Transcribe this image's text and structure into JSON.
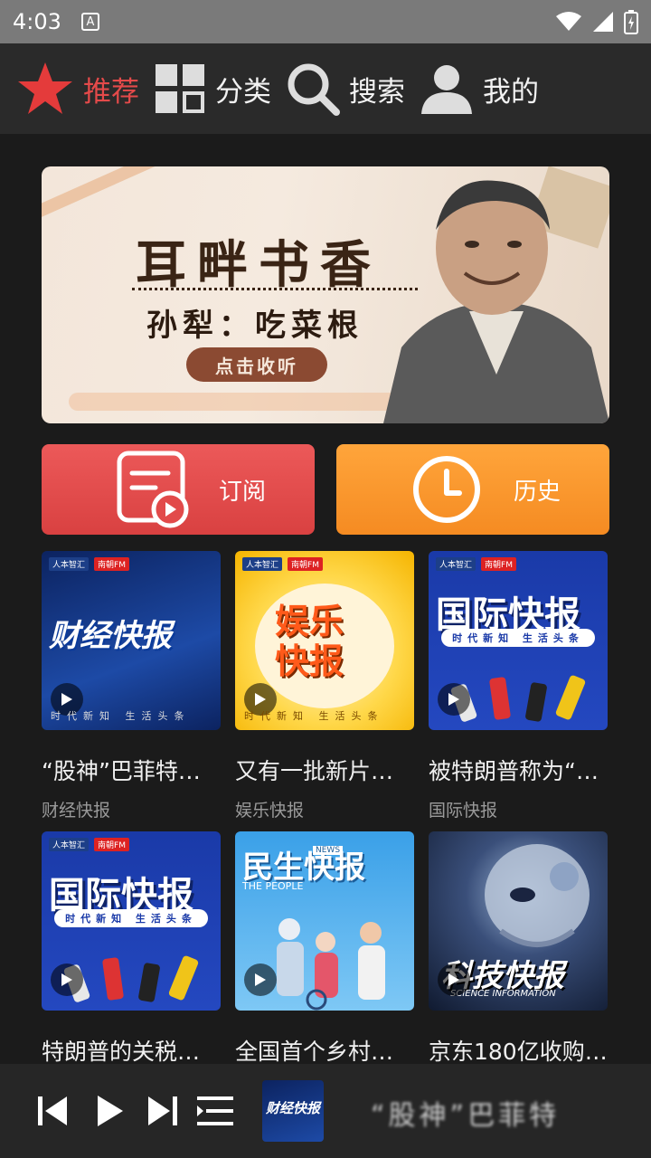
{
  "status_bar": {
    "time": "4:03",
    "notification": "A"
  },
  "nav": {
    "items": [
      {
        "label": "推荐",
        "icon": "star-icon",
        "active": true
      },
      {
        "label": "分类",
        "icon": "grid-icon",
        "active": false
      },
      {
        "label": "搜索",
        "icon": "search-icon",
        "active": false
      },
      {
        "label": "我的",
        "icon": "user-icon",
        "active": false
      }
    ]
  },
  "banner": {
    "title": "耳畔书香",
    "subtitle": "孙犁：吃菜根",
    "button": "点击收听"
  },
  "actions": {
    "subscribe": "订阅",
    "history": "历史"
  },
  "thumb_text": {
    "header_logo": "人本智汇",
    "header_fm": "南朝FM",
    "footer": "时代新知 生活头条",
    "caijing": "财经快报",
    "yule": "娱乐快报",
    "guoji": "国际快报",
    "guoji_bar": "时代新知 生活头条",
    "minsheng": "民生快报",
    "minsheng_news": "NEWS",
    "minsheng_sub": "THE PEOPLE",
    "keji": "科技快报",
    "keji_sub": "SCIENCE INFORMATION"
  },
  "cards": [
    {
      "title": "“股神”巴菲特投…",
      "tag": "财经快报"
    },
    {
      "title": "又有一批新片…",
      "tag": "娱乐快报"
    },
    {
      "title": "被特朗普称为“…",
      "tag": "国际快报"
    },
    {
      "title": "特朗普的关税…",
      "tag": ""
    },
    {
      "title": "全国首个乡村…",
      "tag": ""
    },
    {
      "title": "京东180亿收购…",
      "tag": ""
    }
  ],
  "player": {
    "cover_text": "财经快报",
    "now_playing": "“股神”巴菲特"
  },
  "colors": {
    "accent_red": "#e44a4a",
    "history_orange": "#f58b22",
    "background": "#1b1b1b"
  }
}
